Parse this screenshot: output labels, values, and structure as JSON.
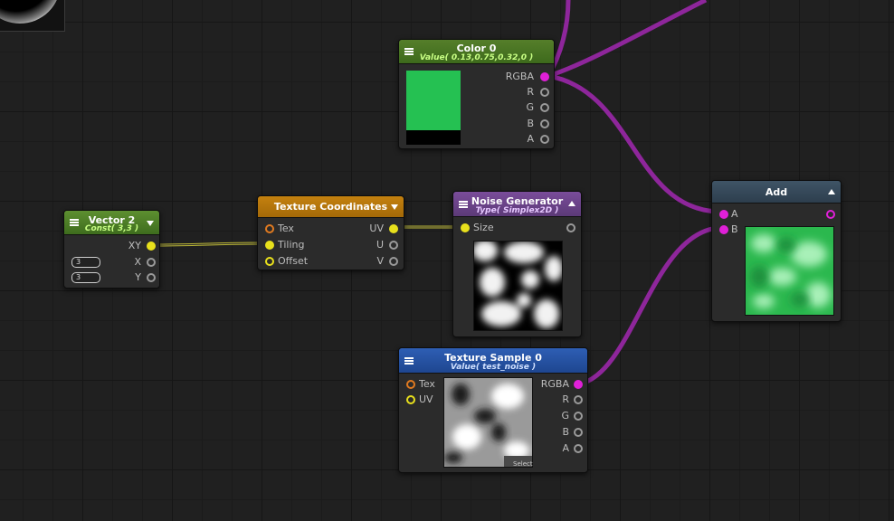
{
  "colors": {
    "wire_color": "#9a27a8",
    "wire_vec": "#c9c332",
    "port_pink": "#e020d8",
    "port_yellow": "#e8e01c",
    "port_orange": "#e07a20",
    "port_grey": "#9a9a9a"
  },
  "nodes": {
    "color0": {
      "title": "Color 0",
      "subtitle": "Value( 0.13,0.75,0.32,0 )",
      "swatch_color": "#25c152",
      "outputs": [
        "RGBA",
        "R",
        "G",
        "B",
        "A"
      ]
    },
    "vector2": {
      "title": "Vector 2",
      "subtitle": "Const( 3,3 )",
      "out": "XY",
      "x_label": "X",
      "y_label": "Y",
      "x_value": "3",
      "y_value": "3"
    },
    "texcoords": {
      "title": "Texture Coordinates",
      "inputs": [
        "Tex",
        "Tiling",
        "Offset"
      ],
      "outputs": [
        "UV",
        "U",
        "V"
      ]
    },
    "noise": {
      "title": "Noise Generator",
      "subtitle": "Type( Simplex2D )",
      "input": "Size"
    },
    "add": {
      "title": "Add",
      "inputs": [
        "A",
        "B"
      ]
    },
    "texsample": {
      "title": "Texture Sample 0",
      "subtitle": "Value( test_noise )",
      "inputs": [
        "Tex",
        "UV"
      ],
      "outputs": [
        "RGBA",
        "R",
        "G",
        "B",
        "A"
      ],
      "select_label": "Select"
    }
  }
}
